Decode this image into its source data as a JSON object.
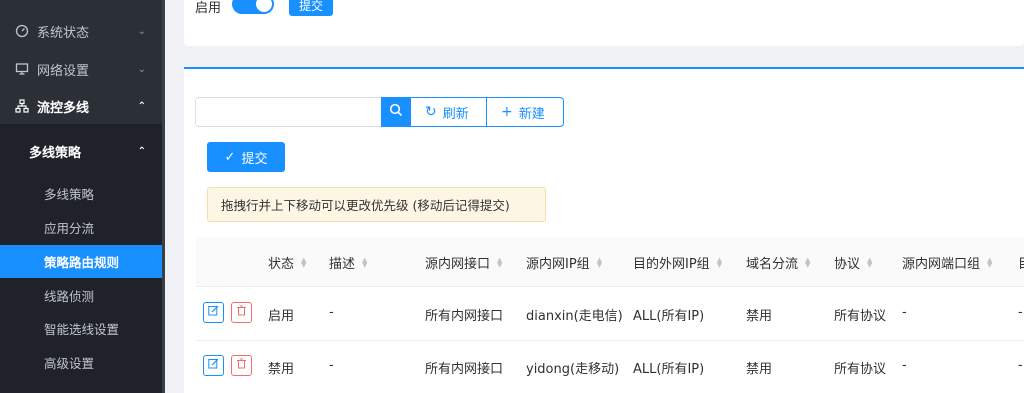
{
  "sidebar": {
    "items": [
      {
        "label": "系统状态",
        "icon": "dashboard-icon"
      },
      {
        "label": "网络设置",
        "icon": "monitor-icon"
      },
      {
        "label": "流控多线",
        "icon": "network-icon"
      }
    ],
    "group": {
      "label": "多线策略"
    },
    "sub_items": [
      {
        "label": "多线策略"
      },
      {
        "label": "应用分流"
      },
      {
        "label": "策略路由规则"
      },
      {
        "label": "线路侦测"
      },
      {
        "label": "智能选线设置"
      },
      {
        "label": "高级设置"
      }
    ],
    "active_sub": "策略路由规则"
  },
  "top": {
    "enable_label": "启用",
    "toggle_on": true,
    "submit_label": "提交"
  },
  "toolbar": {
    "search_placeholder": "",
    "refresh_label": "刷新",
    "new_label": "新建",
    "submit_label": "提交"
  },
  "hint": "拖拽行并上下移动可以更改优先级 (移动后记得提交)",
  "table": {
    "columns": [
      "状态",
      "描述",
      "源内网接口",
      "源内网IP组",
      "目的外网IP组",
      "域名分流",
      "协议",
      "源内网端口组",
      "目"
    ],
    "rows": [
      {
        "status": "启用",
        "desc": "-",
        "src_iface": "所有内网接口",
        "src_ip": "dianxin(走电信)",
        "dst_ip": "ALL(所有IP)",
        "domain": "禁用",
        "proto": "所有协议",
        "src_port": "-",
        "extra": "-"
      },
      {
        "status": "禁用",
        "desc": "-",
        "src_iface": "所有内网接口",
        "src_ip": "yidong(走移动)",
        "dst_ip": "ALL(所有IP)",
        "domain": "禁用",
        "proto": "所有协议",
        "src_port": "-",
        "extra": "-"
      }
    ]
  },
  "colors": {
    "primary": "#1890ff",
    "sidebar_bg": "#2b3036",
    "danger": "#f56c6c",
    "warning_bg": "#fdf6e4"
  }
}
